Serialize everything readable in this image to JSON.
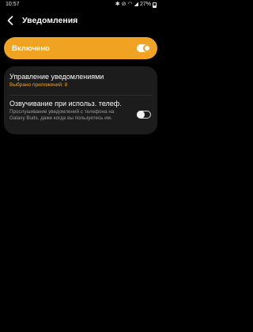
{
  "status_bar": {
    "time": "10:57",
    "battery_percent": "27%"
  },
  "app_bar": {
    "title": "Уведомления",
    "back_icon": "back-arrow-icon"
  },
  "master": {
    "label": "Включено",
    "enabled": true,
    "accent_color": "#f0a322"
  },
  "items": {
    "manage": {
      "title": "Управление уведомлениями",
      "subtitle": "Выбрано приложений: 8"
    },
    "voice": {
      "title": "Озвучивание при использ. телеф.",
      "description": "Прослушивание уведомлений с телефона на Galaxy Buds, даже когда вы пользуетесь им.",
      "enabled": false
    }
  }
}
